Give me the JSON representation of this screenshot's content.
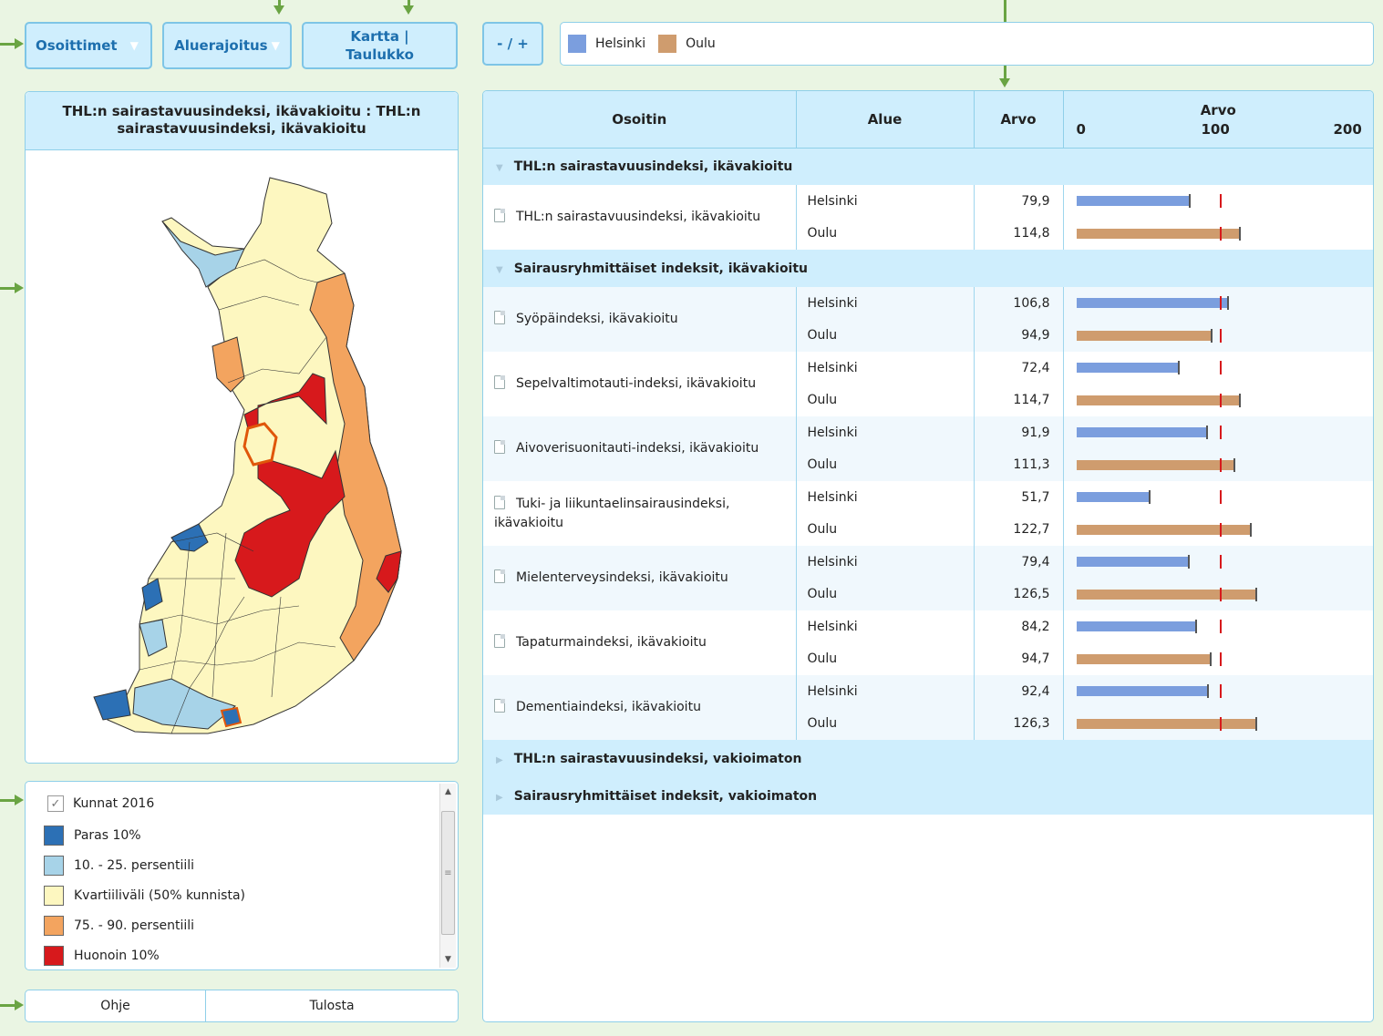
{
  "toolbar": {
    "indicators_label": "Osoittimet",
    "area_label": "Aluerajoitus",
    "mapview_label": "Kartta | Taulukko",
    "zoom_label": "- / +"
  },
  "legend_top": {
    "items": [
      {
        "label": "Helsinki",
        "color": "#7b9ede"
      },
      {
        "label": "Oulu",
        "color": "#cf9c6e"
      }
    ]
  },
  "map": {
    "title": "THL:n sairastavuusindeksi, ikävakioitu : THL:n sairastavuusindeksi, ikävakioitu"
  },
  "map_legend": {
    "layer_label": "Kunnat 2016",
    "classes": [
      {
        "label": "Paras 10%",
        "color": "#2c70b5"
      },
      {
        "label": "10. - 25. persentiili",
        "color": "#a7d3e8"
      },
      {
        "label": "Kvartiiliväli (50% kunnista)",
        "color": "#fdf7c0"
      },
      {
        "label": "75. - 90. persentiili",
        "color": "#f3a45f"
      },
      {
        "label": "Huonoin 10%",
        "color": "#d7191c"
      }
    ]
  },
  "footer": {
    "help_label": "Ohje",
    "print_label": "Tulosta"
  },
  "table": {
    "headers": {
      "indicator": "Osoitin",
      "area": "Alue",
      "value": "Arvo",
      "chart": "Arvo"
    },
    "axis_ticks": [
      "0",
      "100",
      "200"
    ],
    "axis_max": 200,
    "reference": 100,
    "groups": [
      {
        "label": "THL:n sairastavuusindeksi, ikävakioitu",
        "expanded": true,
        "indicators": [
          {
            "name": "THL:n sairastavuusindeksi, ikävakioitu",
            "rows": [
              {
                "area": "Helsinki",
                "value": "79,9",
                "num": 79.9
              },
              {
                "area": "Oulu",
                "value": "114,8",
                "num": 114.8
              }
            ]
          }
        ]
      },
      {
        "label": "Sairausryhmittäiset indeksit, ikävakioitu",
        "expanded": true,
        "indicators": [
          {
            "name": "Syöpäindeksi, ikävakioitu",
            "rows": [
              {
                "area": "Helsinki",
                "value": "106,8",
                "num": 106.8
              },
              {
                "area": "Oulu",
                "value": "94,9",
                "num": 94.9
              }
            ]
          },
          {
            "name": "Sepelvaltimotauti-indeksi, ikävakioitu",
            "rows": [
              {
                "area": "Helsinki",
                "value": "72,4",
                "num": 72.4
              },
              {
                "area": "Oulu",
                "value": "114,7",
                "num": 114.7
              }
            ]
          },
          {
            "name": "Aivoverisuonitauti-indeksi, ikävakioitu",
            "rows": [
              {
                "area": "Helsinki",
                "value": "91,9",
                "num": 91.9
              },
              {
                "area": "Oulu",
                "value": "111,3",
                "num": 111.3
              }
            ]
          },
          {
            "name": "Tuki- ja liikuntaelinsairausindeksi, ikävakioitu",
            "rows": [
              {
                "area": "Helsinki",
                "value": "51,7",
                "num": 51.7
              },
              {
                "area": "Oulu",
                "value": "122,7",
                "num": 122.7
              }
            ]
          },
          {
            "name": "Mielenterveysindeksi, ikävakioitu",
            "rows": [
              {
                "area": "Helsinki",
                "value": "79,4",
                "num": 79.4
              },
              {
                "area": "Oulu",
                "value": "126,5",
                "num": 126.5
              }
            ]
          },
          {
            "name": "Tapaturmaindeksi, ikävakioitu",
            "rows": [
              {
                "area": "Helsinki",
                "value": "84,2",
                "num": 84.2
              },
              {
                "area": "Oulu",
                "value": "94,7",
                "num": 94.7
              }
            ]
          },
          {
            "name": "Dementiaindeksi, ikävakioitu",
            "rows": [
              {
                "area": "Helsinki",
                "value": "92,4",
                "num": 92.4
              },
              {
                "area": "Oulu",
                "value": "126,3",
                "num": 126.3
              }
            ]
          }
        ]
      },
      {
        "label": "THL:n sairastavuusindeksi, vakioimaton",
        "expanded": false,
        "indicators": []
      },
      {
        "label": "Sairausryhmittäiset indeksit, vakioimaton",
        "expanded": false,
        "indicators": []
      }
    ]
  }
}
